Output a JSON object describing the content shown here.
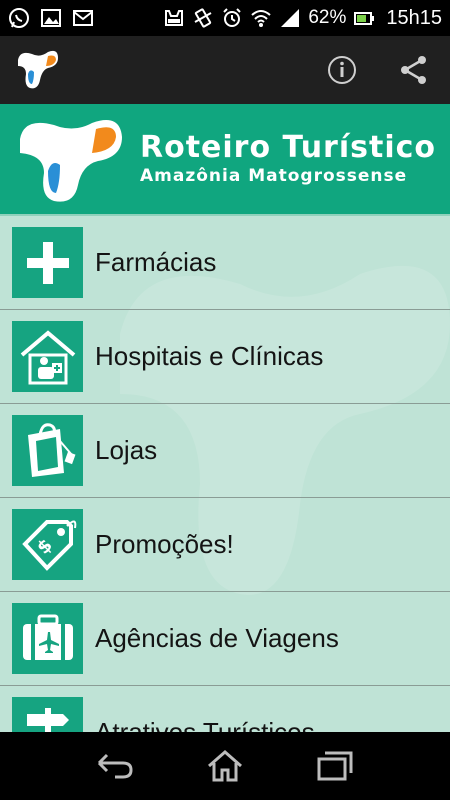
{
  "status_bar": {
    "battery_percent": "62%",
    "time": "15h15",
    "icons": [
      "whatsapp-icon",
      "gallery-icon",
      "gmail-icon",
      "tray-icon",
      "vibrate-icon",
      "alarm-icon",
      "wifi-icon",
      "signal-icon",
      "battery-icon"
    ]
  },
  "action_bar": {
    "actions": [
      "info-icon",
      "share-icon"
    ]
  },
  "banner": {
    "title": "Roteiro Turístico",
    "subtitle": "Amazônia Matogrossense"
  },
  "menu": {
    "items": [
      {
        "label": "Farmácias",
        "icon": "plus-icon"
      },
      {
        "label": "Hospitais e Clínicas",
        "icon": "hospital-icon"
      },
      {
        "label": "Lojas",
        "icon": "shopping-bag-icon"
      },
      {
        "label": "Promoções!",
        "icon": "price-tag-icon"
      },
      {
        "label": "Agências de Viagens",
        "icon": "suitcase-icon"
      },
      {
        "label": "Atrativos Turísticos",
        "icon": "signpost-icon"
      }
    ]
  },
  "nav_bar": {
    "buttons": [
      "back-icon",
      "home-icon",
      "recents-icon"
    ]
  },
  "colors": {
    "accent": "#10a67f",
    "tile": "#16a481",
    "background": "#bfe3d6",
    "action_bar": "#202020"
  }
}
